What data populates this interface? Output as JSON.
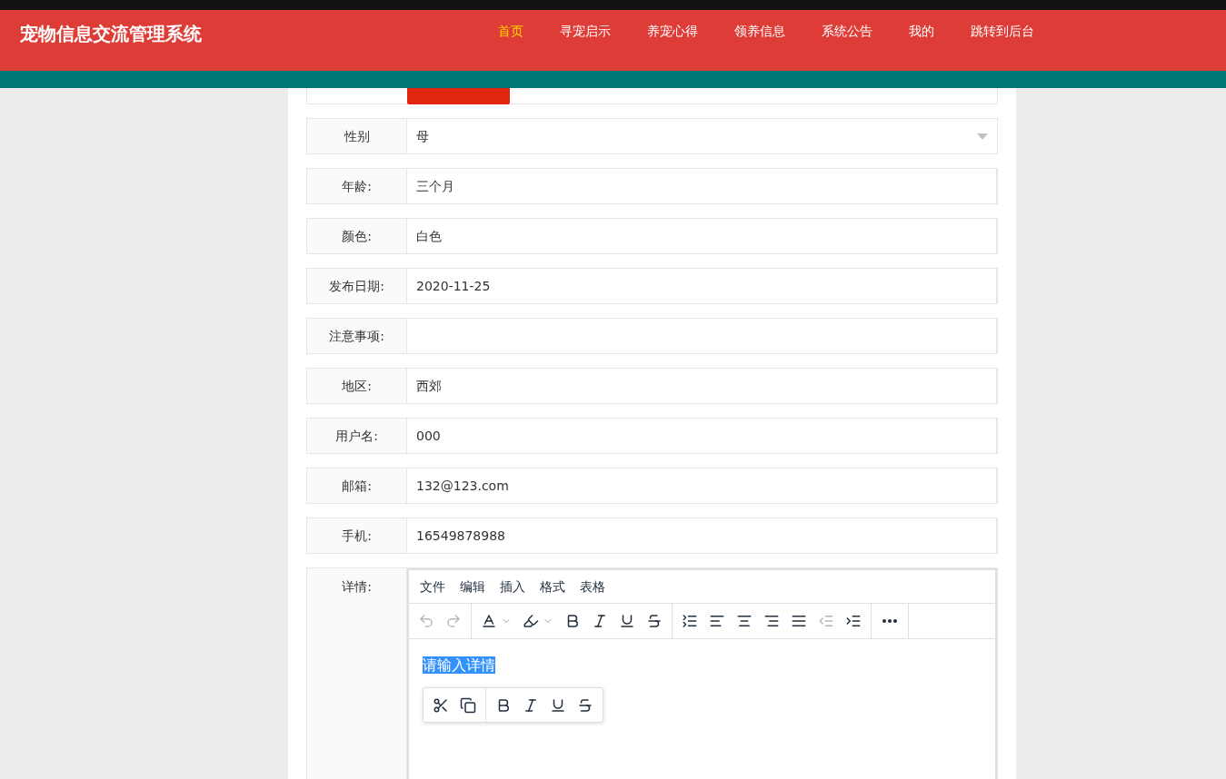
{
  "header": {
    "title": "宠物信息交流管理系统",
    "nav": [
      {
        "label": "首页",
        "selected": true
      },
      {
        "label": "寻宠启示",
        "selected": false
      },
      {
        "label": "养宠心得",
        "selected": false
      },
      {
        "label": "领养信息",
        "selected": false
      },
      {
        "label": "系统公告",
        "selected": false
      },
      {
        "label": "我的",
        "selected": false
      },
      {
        "label": "跳转到后台",
        "selected": false
      }
    ]
  },
  "form": {
    "fields": [
      {
        "kind": "select",
        "label": "性别",
        "value": "母"
      },
      {
        "kind": "text",
        "label": "年龄:",
        "value": "三个月"
      },
      {
        "kind": "text",
        "label": "颜色:",
        "value": "白色"
      },
      {
        "kind": "text",
        "label": "发布日期:",
        "value": "2020-11-25"
      },
      {
        "kind": "text",
        "label": "注意事项:"
      },
      {
        "kind": "text",
        "label": "地区:",
        "value": "西郊"
      },
      {
        "kind": "text",
        "label": "用户名:",
        "value": "000"
      },
      {
        "kind": "text",
        "label": "邮箱:",
        "value": "132@123.com"
      },
      {
        "kind": "text",
        "label": "手机:",
        "value": "16549878988"
      }
    ],
    "editor": {
      "label": "详情:",
      "menu": [
        "文件",
        "编辑",
        "插入",
        "格式",
        "表格"
      ],
      "toolbar": [
        [
          {
            "kind": "undo",
            "disabled": true
          },
          {
            "kind": "redo",
            "disabled": true
          }
        ],
        [
          {
            "kind": "text-color",
            "disabled": false
          },
          {
            "kind": "highlight",
            "disabled": false
          },
          {
            "kind": "bold",
            "disabled": false
          },
          {
            "kind": "italic",
            "disabled": false
          },
          {
            "kind": "underline",
            "disabled": false
          },
          {
            "kind": "strikethrough",
            "disabled": false
          }
        ],
        [
          {
            "kind": "line-height",
            "disabled": false
          },
          {
            "kind": "align-left",
            "disabled": false
          },
          {
            "kind": "align-center",
            "disabled": false
          },
          {
            "kind": "align-right",
            "disabled": false
          },
          {
            "kind": "align-justify",
            "disabled": false
          },
          {
            "kind": "outdent",
            "disabled": true
          },
          {
            "kind": "indent",
            "disabled": false
          }
        ],
        [
          {
            "kind": "more",
            "disabled": false
          }
        ]
      ],
      "content": "请输入详情",
      "content_selected": true,
      "context_toolbar": [
        [
          {
            "kind": "cut"
          },
          {
            "kind": "copy"
          }
        ],
        [
          {
            "kind": "bold"
          },
          {
            "kind": "italic"
          },
          {
            "kind": "underline"
          },
          {
            "kind": "strikethrough"
          }
        ]
      ]
    }
  }
}
